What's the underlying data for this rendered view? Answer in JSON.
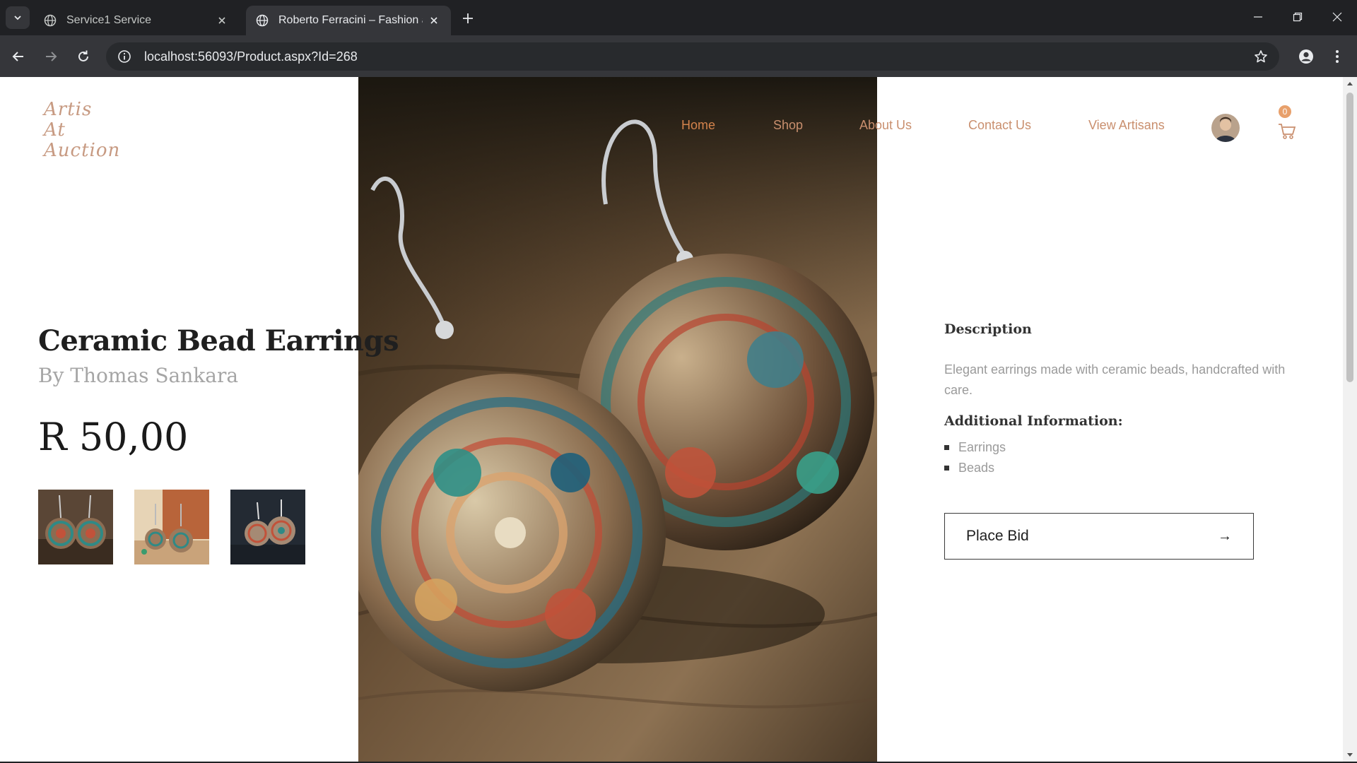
{
  "browser": {
    "tabs": [
      {
        "title": "Service1 Service",
        "active": false
      },
      {
        "title": "Roberto Ferracini – Fashion and",
        "active": true
      }
    ],
    "url": "localhost:56093/Product.aspx?Id=268"
  },
  "site": {
    "logo_lines": [
      "Artis",
      "At",
      "Auction"
    ],
    "nav": [
      "Home",
      "Shop",
      "About Us",
      "Contact Us",
      "View Artisans"
    ],
    "cart_count": "0"
  },
  "product": {
    "title": "Ceramic Bead Earrings",
    "artist": "By Thomas Sankara",
    "price": "R 50,00",
    "description_heading": "Description",
    "description": "Elegant earrings made with ceramic beads, handcrafted with care.",
    "additional_heading": "Additional Information:",
    "tags": [
      "Earrings",
      "Beads"
    ],
    "bid_label": "Place Bid",
    "bid_arrow": "→"
  },
  "colors": {
    "accent": "#d4834c",
    "nav_link": "#c98f6e",
    "logo": "#c79a82",
    "browser_bg": "#202124",
    "toolbar_bg": "#35363a"
  }
}
